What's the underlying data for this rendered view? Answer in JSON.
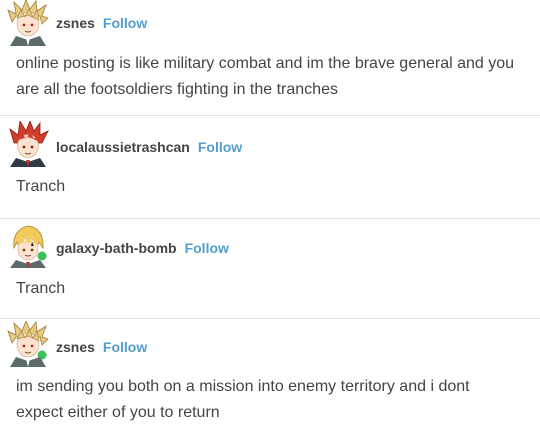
{
  "posts": [
    {
      "username": "zsnes",
      "follow_label": "Follow",
      "avatar_icon": "avatar-blonde-spiky-icon",
      "text": "online posting is like military combat and im the brave general and you are all the footsoldiers fighting in the tranches"
    },
    {
      "username": "localaussietrashcan",
      "follow_label": "Follow",
      "avatar_icon": "avatar-red-spiky-icon",
      "text": "Tranch"
    },
    {
      "username": "galaxy-bath-bomb",
      "follow_label": "Follow",
      "avatar_icon": "avatar-yellow-hair-icon",
      "text": "Tranch"
    },
    {
      "username": "zsnes",
      "follow_label": "Follow",
      "avatar_icon": "avatar-blonde-spiky-icon",
      "text": "im sending you both on a mission into enemy territory and i dont expect either of you to return"
    }
  ],
  "colors": {
    "follow": "#529ecc",
    "text": "#444444",
    "divider": "#e4e4e4"
  }
}
